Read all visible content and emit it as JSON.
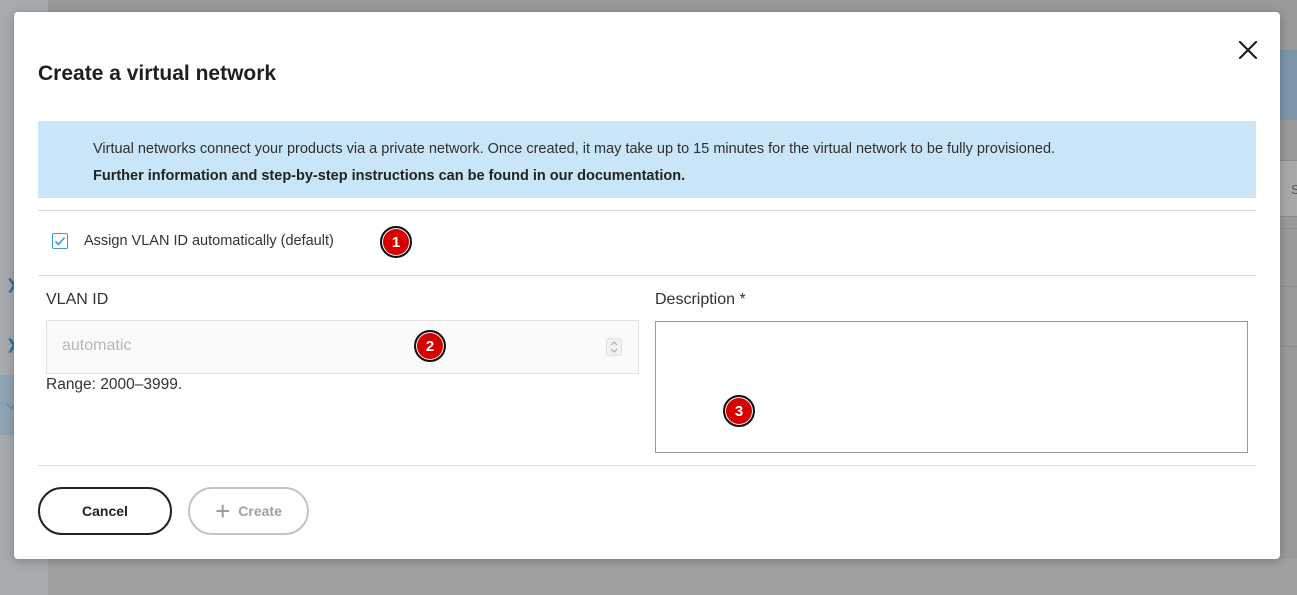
{
  "dialog": {
    "title": "Create a virtual network",
    "info_text": "Virtual networks connect your products via a private network. Once created, it may take up to 15 minutes for the virtual network to be fully provisioned.",
    "info_bold": "Further information and step-by-step instructions can be found in our documentation.",
    "checkbox": {
      "label": "Assign VLAN ID automatically (default)",
      "checked": true
    },
    "vlan": {
      "label": "VLAN ID",
      "placeholder": "automatic",
      "hint": "Range: 2000–3999."
    },
    "description": {
      "label": "Description *",
      "value": ""
    },
    "buttons": {
      "cancel": "Cancel",
      "create": "Create"
    },
    "markers": [
      "1",
      "2",
      "3"
    ]
  },
  "background": {
    "partial_text": "S"
  },
  "colors": {
    "info_bg": "#c9e6f8",
    "checkbox_accent": "#3a9bd1",
    "marker_red": "#d60000"
  }
}
